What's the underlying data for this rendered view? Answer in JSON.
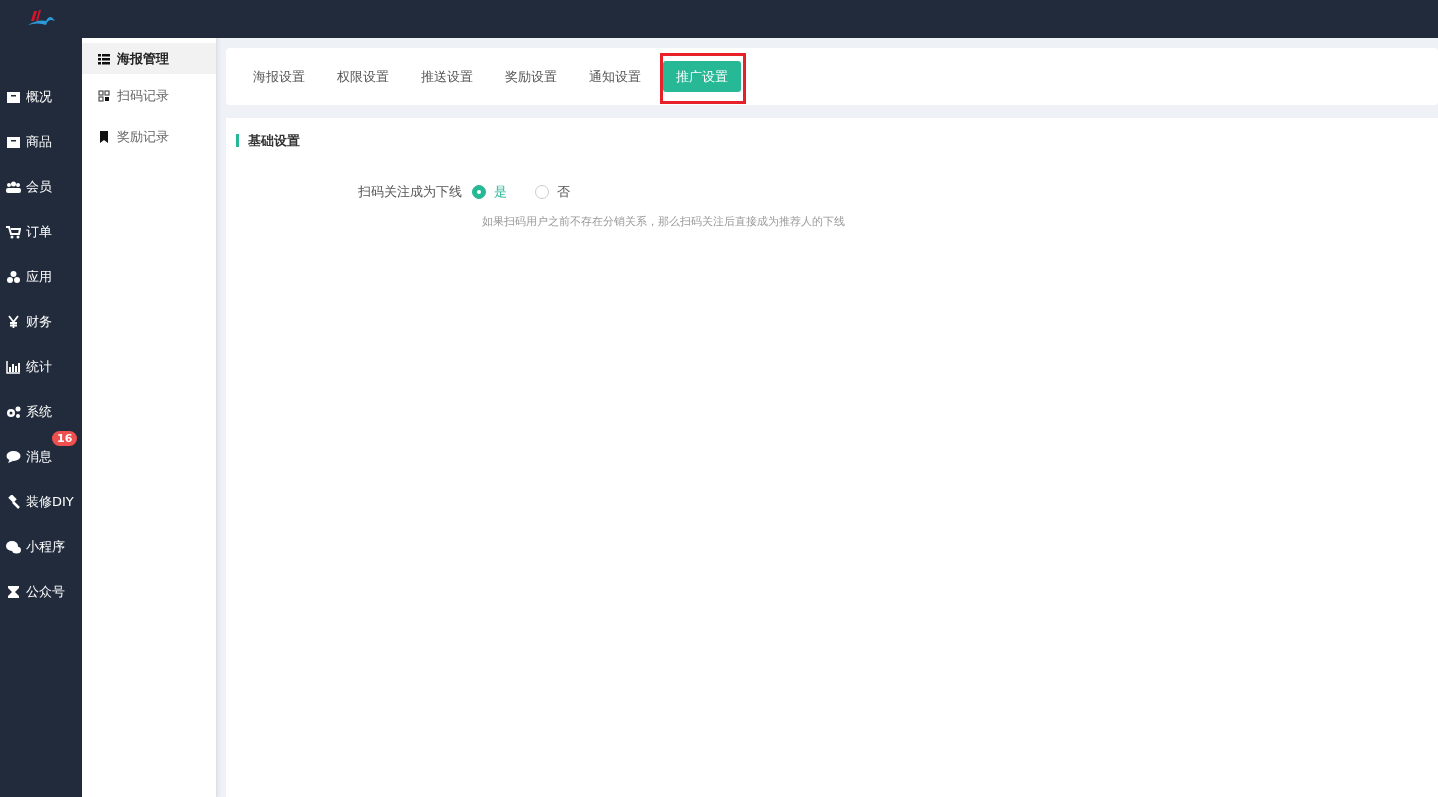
{
  "nav": {
    "items": [
      {
        "label": "概况",
        "selected": false
      },
      {
        "label": "商品",
        "selected": false
      },
      {
        "label": "会员",
        "selected": false
      },
      {
        "label": "订单",
        "selected": false
      },
      {
        "label": "应用",
        "selected": false
      },
      {
        "label": "财务",
        "selected": false
      },
      {
        "label": "统计",
        "selected": false
      },
      {
        "label": "系统",
        "selected": false
      },
      {
        "label": "消息",
        "selected": false,
        "badge": "16"
      },
      {
        "label": "装修DIY",
        "selected": false
      },
      {
        "label": "小程序",
        "selected": false
      },
      {
        "label": "公众号",
        "selected": false
      }
    ]
  },
  "submenu": {
    "items": [
      {
        "label": "海报管理",
        "selected": true
      },
      {
        "label": "扫码记录",
        "selected": false
      },
      {
        "label": "奖励记录",
        "selected": false
      }
    ]
  },
  "tabs": [
    {
      "label": "海报设置",
      "selected": false,
      "highlighted": false
    },
    {
      "label": "权限设置",
      "selected": false,
      "highlighted": false
    },
    {
      "label": "推送设置",
      "selected": false,
      "highlighted": false
    },
    {
      "label": "奖励设置",
      "selected": false,
      "highlighted": false
    },
    {
      "label": "通知设置",
      "selected": false,
      "highlighted": false
    },
    {
      "label": "推广设置",
      "selected": true,
      "highlighted": true
    }
  ],
  "section": {
    "title": "基础设置",
    "fields": [
      {
        "label": "扫码关注成为下线",
        "options": [
          {
            "label": "是",
            "selected": true
          },
          {
            "label": "否",
            "selected": false
          }
        ],
        "help": "如果扫码用户之前不存在分销关系，那么扫码关注后直接成为推荐人的下线"
      }
    ]
  }
}
